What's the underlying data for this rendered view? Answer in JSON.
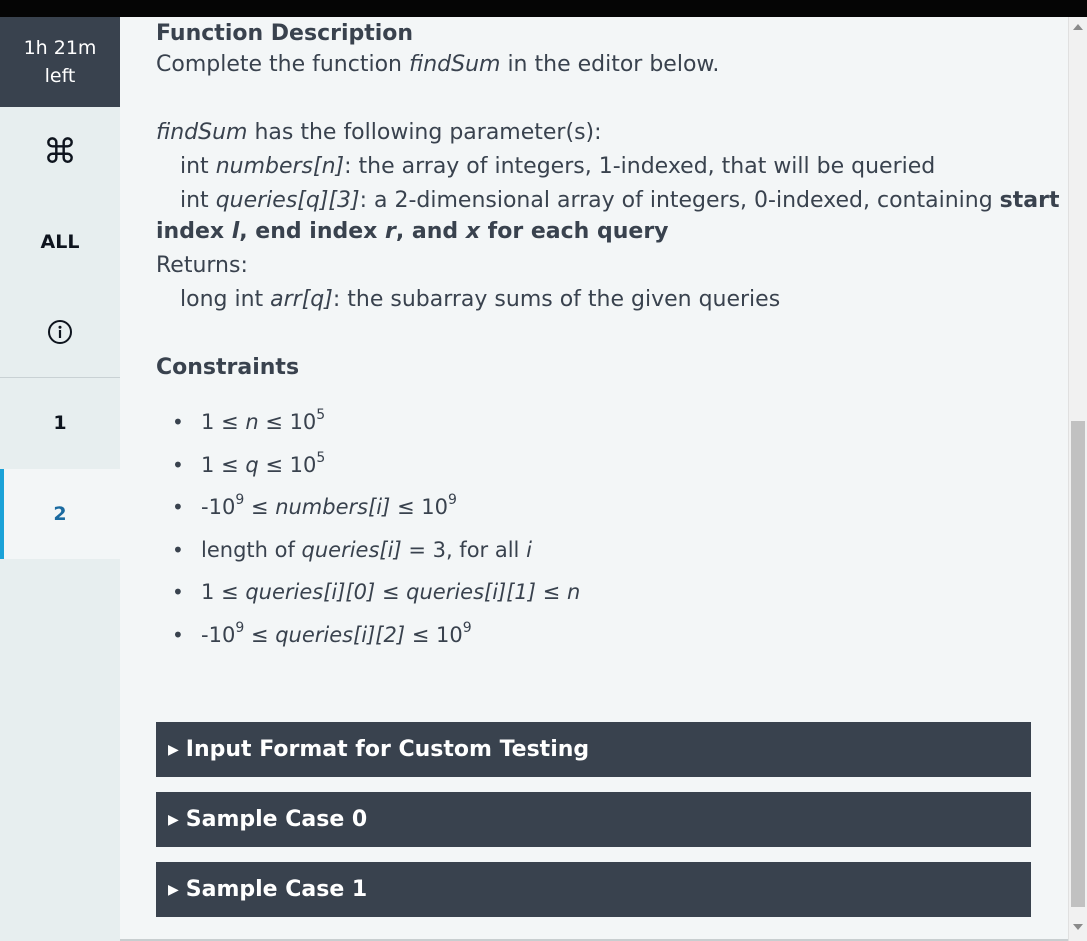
{
  "timer": {
    "line1": "1h 21m",
    "line2": "left"
  },
  "sidebar": {
    "cmd_glyph": "⌘",
    "all_label": "ALL",
    "info_icon": "info-icon",
    "questions": [
      "1",
      "2"
    ],
    "active_question": "2",
    "accent_color": "#1ba2d8"
  },
  "desc": {
    "title": "Function Description",
    "intro_pre": "Complete the function ",
    "fn": "findSum",
    "intro_post": " in the editor below.",
    "params_post": " has the following parameter(s):",
    "p1_type": "int ",
    "p1_name": "numbers[n]",
    "p1_desc": ": the array of integers, 1-indexed, that will be queried",
    "p2_type": "int ",
    "p2_name": "queries[q][3]",
    "p2_desc": ": a 2-dimensional array of integers, 0-indexed, containing ",
    "p2_bold1": "start",
    "p2_bold2": "index ",
    "p2_l": "l",
    "p2_bold3": ", end index ",
    "p2_r": "r",
    "p2_bold4": ", and ",
    "p2_x": "x",
    "p2_bold5": " for each query",
    "returns": "Returns:",
    "ret_type": "long int ",
    "ret_name": "arr[q]",
    "ret_desc": ": the subarray sums of the given queries"
  },
  "constraints": {
    "title": "Constraints",
    "c1_a": "1 ≤ ",
    "c1_n": "n",
    "c1_b": " ≤ 10",
    "c1_sup": "5",
    "c2_a": "1 ≤ ",
    "c2_q": "q",
    "c2_b": " ≤ 10",
    "c2_sup": "5",
    "c3_a": "-10",
    "c3_sup1": "9",
    "c3_b": " ≤ ",
    "c3_v": "numbers[i]",
    "c3_c": " ≤ 10",
    "c3_sup2": "9",
    "c4_a": "length of ",
    "c4_v": "queries[i]",
    "c4_b": " = 3, for all ",
    "c4_i": "i",
    "c5_a": "1 ≤ ",
    "c5_v1": "queries[i][0]",
    "c5_b": " ≤ ",
    "c5_v2": "queries[i][1]",
    "c5_c": " ≤ ",
    "c5_n": "n",
    "c6_a": "-10",
    "c6_sup1": "9",
    "c6_b": " ≤ ",
    "c6_v": "queries[i][2]",
    "c6_c": " ≤ 10",
    "c6_sup2": "9"
  },
  "accordions": [
    {
      "label": "Input Format for Custom Testing"
    },
    {
      "label": "Sample Case 0"
    },
    {
      "label": "Sample Case 1"
    }
  ],
  "colors": {
    "dark_panel": "#39424e",
    "background": "#f3f6f7",
    "sidebar": "#e7eeef"
  }
}
